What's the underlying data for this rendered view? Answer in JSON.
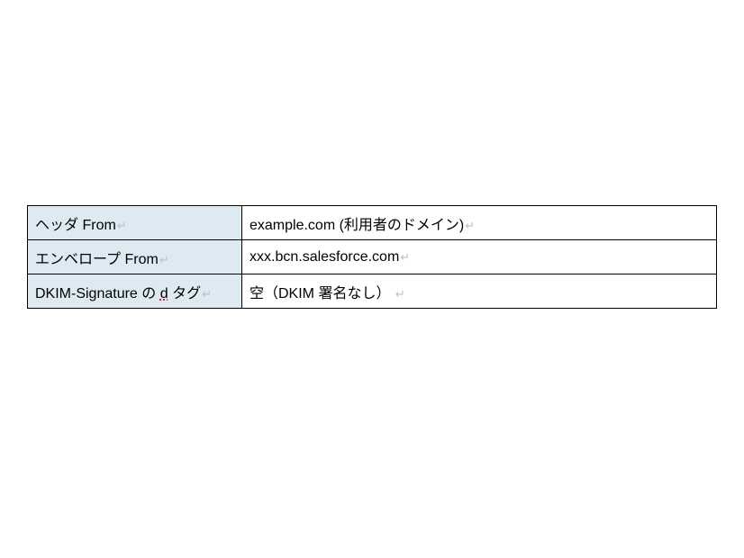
{
  "table": {
    "rows": [
      {
        "label_parts": {
          "prefix": "ヘッダ",
          "mid": " From",
          "suffix": ""
        },
        "value": "example.com (利用者のドメイン)"
      },
      {
        "label_parts": {
          "prefix": "エンベロープ",
          "mid": " From",
          "suffix": ""
        },
        "value": "xxx.bcn.salesforce.com"
      },
      {
        "label_parts": {
          "prefix": "DKIM-Signature  の ",
          "dotted": "d",
          "mid": " タグ",
          "suffix": ""
        },
        "value": "空（DKIM 署名なし） "
      }
    ]
  },
  "paragraph_mark": "↵"
}
